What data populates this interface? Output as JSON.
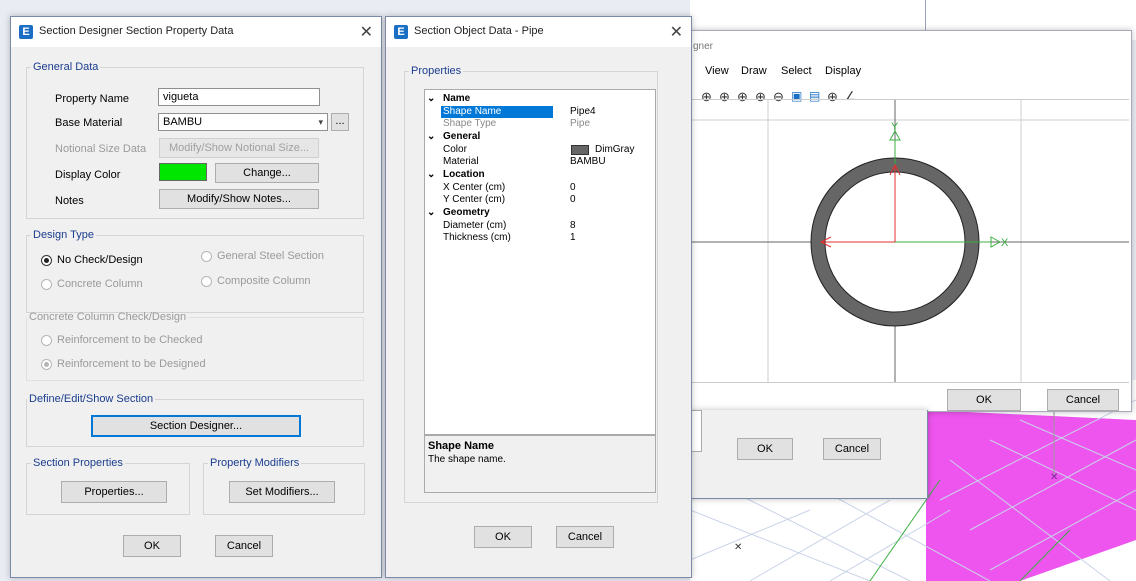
{
  "dialog1": {
    "title": "Section Designer Section Property Data",
    "general_legend": "General Data",
    "property_name_label": "Property Name",
    "property_name_value": "vigueta",
    "base_material_label": "Base Material",
    "base_material_value": "BAMBU",
    "ellipsis_label": "...",
    "notional_size_label": "Notional Size Data",
    "notional_size_button": "Modify/Show Notional Size...",
    "display_color_label": "Display Color",
    "display_color_value": "#00e600",
    "change_button": "Change...",
    "notes_label": "Notes",
    "notes_button": "Modify/Show Notes...",
    "design_type_legend": "Design Type",
    "no_check_design": "No Check/Design",
    "general_steel_section": "General Steel Section",
    "concrete_column": "Concrete Column",
    "composite_column": "Composite Column",
    "concrete_check_legend": "Concrete Column Check/Design",
    "reinforcement_checked": "Reinforcement to be Checked",
    "reinforcement_designed": "Reinforcement to be Designed",
    "define_legend": "Define/Edit/Show Section",
    "section_designer_button": "Section Designer...",
    "section_properties_legend": "Section Properties",
    "properties_button": "Properties...",
    "property_modifiers_legend": "Property Modifiers",
    "set_modifiers_button": "Set Modifiers...",
    "ok": "OK",
    "cancel": "Cancel"
  },
  "dialog2": {
    "title": "Section Object Data - Pipe",
    "properties_legend": "Properties",
    "rows": {
      "name_cat": "Name",
      "shape_name_label": "Shape Name",
      "shape_name_value": "Pipe4",
      "shape_type_label": "Shape Type",
      "shape_type_value": "Pipe",
      "general_cat": "General",
      "color_label": "Color",
      "color_value": "DimGray",
      "material_label": "Material",
      "material_value": "BAMBU",
      "location_cat": "Location",
      "xcenter_label": "X Center (cm)",
      "xcenter_value": "0",
      "ycenter_label": "Y Center (cm)",
      "ycenter_value": "0",
      "geometry_cat": "Geometry",
      "diameter_label": "Diameter (cm)",
      "diameter_value": "8",
      "thickness_label": "Thickness (cm)",
      "thickness_value": "1"
    },
    "desc_title": "Shape Name",
    "desc_text": "The shape name.",
    "ok": "OK",
    "cancel": "Cancel"
  },
  "designer": {
    "title_fragment": "gner",
    "menu": [
      "View",
      "Draw",
      "Select",
      "Display"
    ],
    "ok": "OK",
    "cancel": "Cancel",
    "pipe_color": "#666666"
  },
  "behind_dialog": {
    "ok": "OK",
    "cancel": "Cancel"
  },
  "axes": {
    "x": "X",
    "y": "Y"
  },
  "colors": {
    "accent": "#0078d7",
    "pink": "#ee55ee",
    "grid": "#3cb043"
  }
}
